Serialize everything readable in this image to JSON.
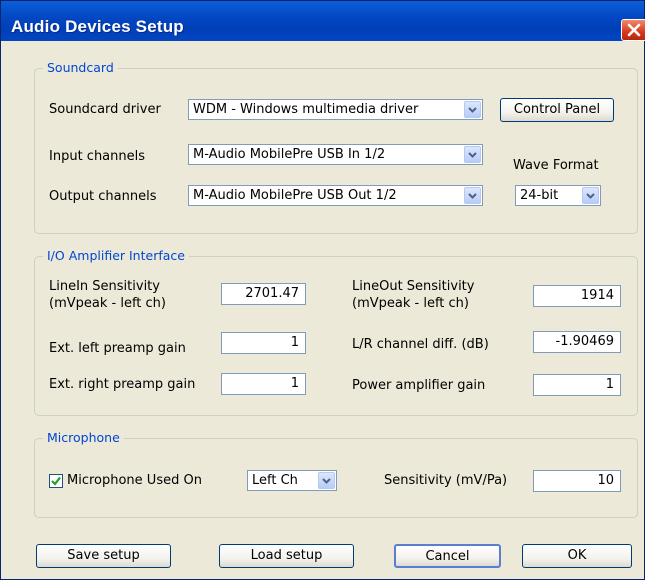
{
  "window": {
    "title": "Audio Devices Setup"
  },
  "soundcard": {
    "group_title": "Soundcard",
    "driver_label": "Soundcard driver",
    "driver_value": "WDM - Windows multimedia driver",
    "control_panel_label": "Control Panel",
    "input_label": "Input channels",
    "input_value": "M-Audio MobilePre USB In 1/2",
    "output_label": "Output channels",
    "output_value": "M-Audio MobilePre USB Out 1/2",
    "wave_format_label": "Wave Format",
    "wave_format_value": "24-bit"
  },
  "io": {
    "group_title": "I/O Amplifier Interface",
    "linein_label_1": "LineIn Sensitivity",
    "linein_label_2": "(mVpeak - left ch)",
    "linein_value": "2701.47",
    "lineout_label_1": "LineOut Sensitivity",
    "lineout_label_2": "(mVpeak - left ch)",
    "lineout_value": "1914",
    "ext_left_label": "Ext. left preamp gain",
    "ext_left_value": "1",
    "lr_diff_label": "L/R channel diff. (dB)",
    "lr_diff_value": "-1.90469",
    "ext_right_label": "Ext. right preamp gain",
    "ext_right_value": "1",
    "power_amp_label": "Power amplifier gain",
    "power_amp_value": "1"
  },
  "microphone": {
    "group_title": "Microphone",
    "used_on_label": "Microphone Used On",
    "used_on_checked": true,
    "channel_value": "Left Ch",
    "sensitivity_label": "Sensitivity (mV/Pa)",
    "sensitivity_value": "10"
  },
  "buttons": {
    "save": "Save setup",
    "load": "Load setup",
    "cancel": "Cancel",
    "ok": "OK"
  },
  "colors": {
    "title_bar": "#0447c3",
    "dialog_bg": "#ece9d8",
    "group_title": "#0046d5",
    "close_button": "#d6381b"
  }
}
